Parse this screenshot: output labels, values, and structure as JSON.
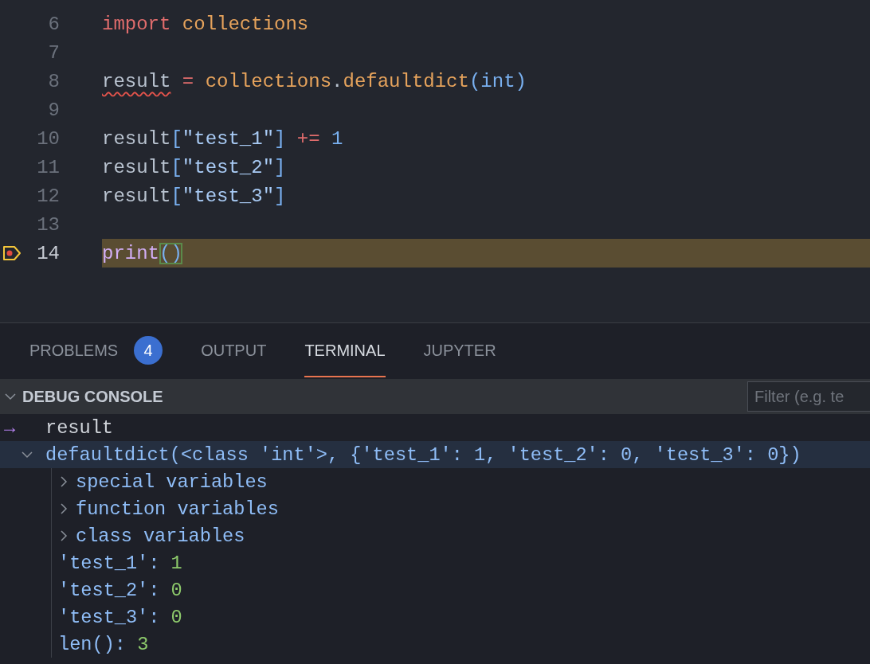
{
  "editor": {
    "lines": [
      {
        "number": "6",
        "current": false,
        "breakpoint": false,
        "tokens": [
          {
            "text": "import ",
            "kind": "keyword"
          },
          {
            "text": "collections",
            "kind": "module"
          }
        ]
      },
      {
        "number": "7",
        "current": false,
        "breakpoint": false
      },
      {
        "number": "8",
        "current": false,
        "breakpoint": false,
        "tokens": [
          {
            "text": "result",
            "kind": "variable",
            "error": true
          },
          {
            "text": " = ",
            "kind": "operator"
          },
          {
            "text": "collections",
            "kind": "module"
          },
          {
            "text": ".",
            "kind": "plain"
          },
          {
            "text": "defaultdict",
            "kind": "module"
          },
          {
            "text": "(",
            "kind": "bracket"
          },
          {
            "text": "int",
            "kind": "builtin"
          },
          {
            "text": ")",
            "kind": "bracket"
          }
        ]
      },
      {
        "number": "9",
        "current": false,
        "breakpoint": false
      },
      {
        "number": "10",
        "current": false,
        "breakpoint": false,
        "tokens": [
          {
            "text": "result",
            "kind": "variable"
          },
          {
            "text": "[",
            "kind": "bracket"
          },
          {
            "text": "\"test_1\"",
            "kind": "string"
          },
          {
            "text": "]",
            "kind": "bracket"
          },
          {
            "text": " += ",
            "kind": "operator"
          },
          {
            "text": "1",
            "kind": "number"
          }
        ]
      },
      {
        "number": "11",
        "current": false,
        "breakpoint": false,
        "tokens": [
          {
            "text": "result",
            "kind": "variable"
          },
          {
            "text": "[",
            "kind": "bracket"
          },
          {
            "text": "\"test_2\"",
            "kind": "string"
          },
          {
            "text": "]",
            "kind": "bracket"
          }
        ]
      },
      {
        "number": "12",
        "current": false,
        "breakpoint": false,
        "tokens": [
          {
            "text": "result",
            "kind": "variable"
          },
          {
            "text": "[",
            "kind": "bracket"
          },
          {
            "text": "\"test_3\"",
            "kind": "string"
          },
          {
            "text": "]",
            "kind": "bracket"
          }
        ]
      },
      {
        "number": "13",
        "current": false,
        "breakpoint": false
      },
      {
        "number": "14",
        "current": true,
        "breakpoint": true,
        "tokens": [
          {
            "text": "print",
            "kind": "function"
          },
          {
            "text": "()",
            "kind": "bracket",
            "matched": true
          }
        ]
      }
    ]
  },
  "panel": {
    "tabs": [
      {
        "label": "PROBLEMS",
        "selected": false,
        "badge": "4"
      },
      {
        "label": "OUTPUT",
        "selected": false
      },
      {
        "label": "TERMINAL",
        "selected": true
      },
      {
        "label": "JUPYTER",
        "selected": false
      }
    ],
    "debug_console": {
      "title": "DEBUG CONSOLE",
      "expanded": true,
      "filter": {
        "placeholder": "Filter (e.g. te"
      },
      "input": {
        "prompt": "→",
        "text": "result"
      },
      "output": {
        "text": "defaultdict(<class 'int'>, {'test_1': 1, 'test_2': 0, 'test_3': 0})",
        "expanded": true,
        "selected": true,
        "children": [
          {
            "kind": "group",
            "label": "special variables",
            "expanded": false
          },
          {
            "kind": "group",
            "label": "function variables",
            "expanded": false
          },
          {
            "kind": "group",
            "label": "class variables",
            "expanded": false
          },
          {
            "kind": "entry",
            "key": "'test_1':",
            "value": "1"
          },
          {
            "kind": "entry",
            "key": "'test_2':",
            "value": "0"
          },
          {
            "kind": "entry",
            "key": "'test_3':",
            "value": "0"
          },
          {
            "kind": "entry",
            "key": "len():",
            "value": "3"
          }
        ]
      }
    }
  }
}
